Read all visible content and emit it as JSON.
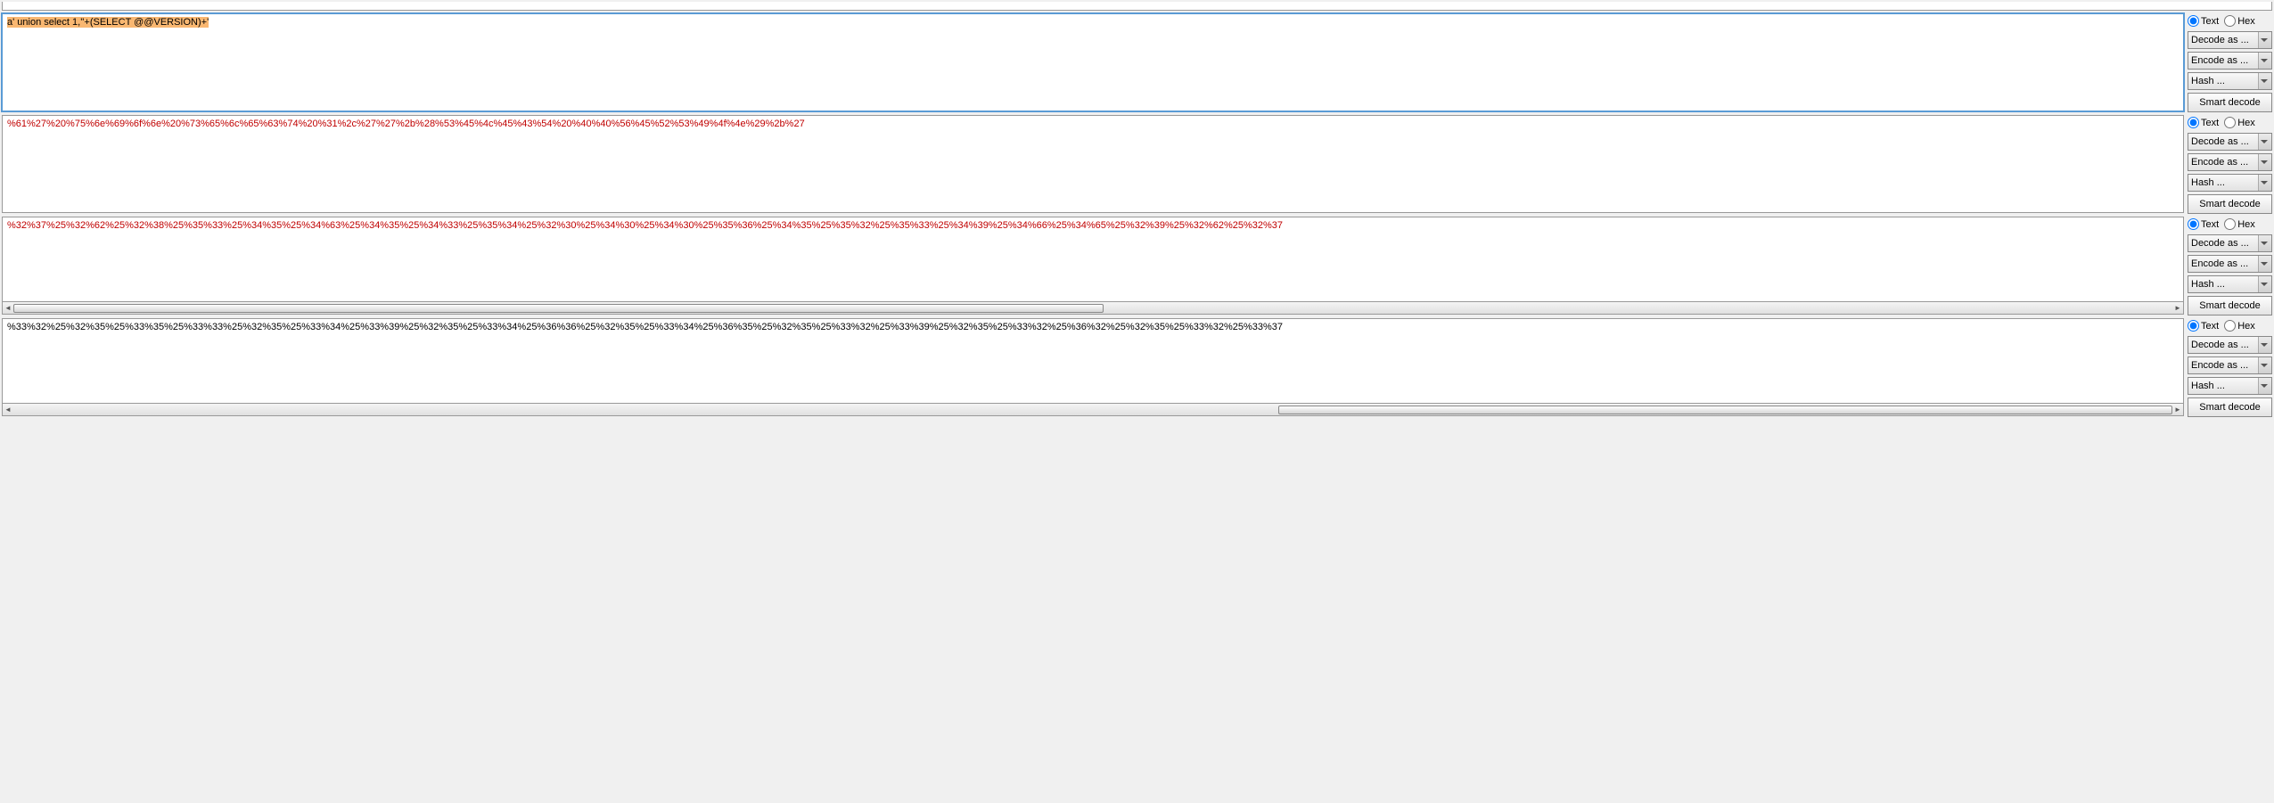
{
  "panels": [
    {
      "text": "a' union select 1,''+(SELECT @@VERSION)+'",
      "highlighted": true,
      "text_color": "black",
      "active": true,
      "has_scrollbar": false,
      "radio_selected": "text"
    },
    {
      "text": "%61%27%20%75%6e%69%6f%6e%20%73%65%6c%65%63%74%20%31%2c%27%27%2b%28%53%45%4c%45%43%54%20%40%40%56%45%52%53%49%4f%4e%29%2b%27",
      "highlighted": false,
      "text_color": "red",
      "active": false,
      "has_scrollbar": false,
      "radio_selected": "text"
    },
    {
      "text": "%32%37%25%32%62%25%32%38%25%35%33%25%34%35%25%34%63%25%34%35%25%34%33%25%35%34%25%32%30%25%34%30%25%34%30%25%35%36%25%34%35%25%35%32%25%35%33%25%34%39%25%34%66%25%34%65%25%32%39%25%32%62%25%32%37",
      "highlighted": false,
      "text_color": "red",
      "active": false,
      "has_scrollbar": true,
      "radio_selected": "text"
    },
    {
      "text": "%33%32%25%32%35%25%33%35%25%33%33%25%32%35%25%33%34%25%33%39%25%32%35%25%33%34%25%36%36%25%32%35%25%33%34%25%36%35%25%32%35%25%33%32%25%33%39%25%32%35%25%33%32%25%36%32%25%32%35%25%33%32%25%33%37",
      "highlighted": false,
      "text_color": "black",
      "active": false,
      "has_scrollbar": true,
      "radio_selected": "text"
    }
  ],
  "controls": {
    "radio_text_label": "Text",
    "radio_hex_label": "Hex",
    "decode_label": "Decode as ...",
    "encode_label": "Encode as ...",
    "hash_label": "Hash ...",
    "smart_decode_label": "Smart decode"
  }
}
